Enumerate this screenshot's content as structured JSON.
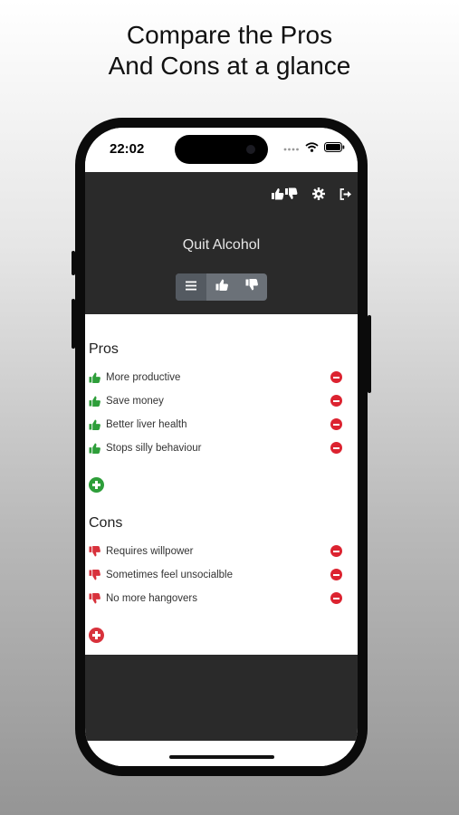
{
  "headline": {
    "line1": "Compare the Pros",
    "line2": "And Cons at a glance"
  },
  "status_bar": {
    "time": "22:02",
    "icons": [
      "signal-dots-icon",
      "wifi-icon",
      "battery-icon"
    ]
  },
  "header": {
    "actions": [
      "thumbs-up-down-icon",
      "gear-icon",
      "logout-icon"
    ],
    "title": "Quit Alcohol",
    "segments": [
      {
        "icon": "list-icon",
        "active": true
      },
      {
        "icon": "thumbs-up-icon",
        "active": false
      },
      {
        "icon": "thumbs-down-icon",
        "active": false
      }
    ]
  },
  "pros": {
    "title": "Pros",
    "items": [
      "More productive",
      "Save money",
      "Better liver health",
      "Stops silly behaviour"
    ]
  },
  "cons": {
    "title": "Cons",
    "items": [
      "Requires willpower",
      "Sometimes feel unsocialble",
      "No more hangovers"
    ]
  },
  "colors": {
    "pro": "#2e9e3a",
    "con": "#d8323c",
    "remove": "#dc2330",
    "header_bg": "#2a2a2a"
  }
}
